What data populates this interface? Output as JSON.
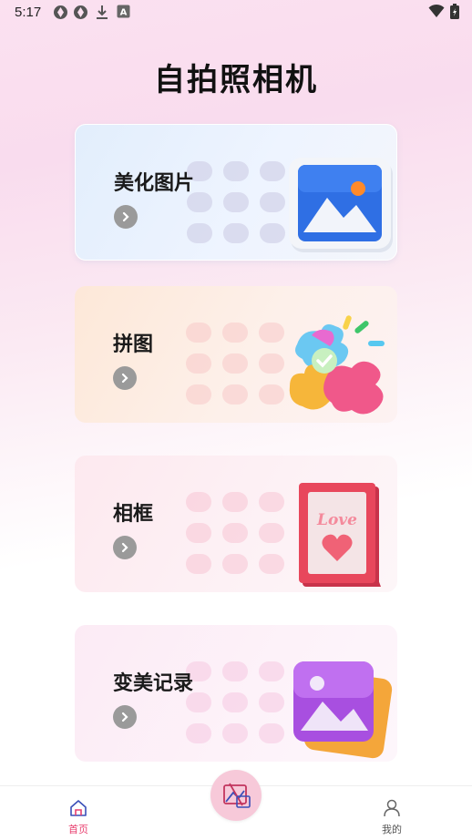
{
  "status_bar": {
    "time": "5:17",
    "icons": [
      "aperture-icon",
      "aperture-icon",
      "download-icon",
      "font-icon",
      "wifi-icon",
      "battery-charging-icon"
    ]
  },
  "page": {
    "title": "自拍照相机"
  },
  "cards": [
    {
      "label": "美化图片",
      "icon": "photo-frame-icon",
      "accent": "#2f6fe4"
    },
    {
      "label": "拼图",
      "icon": "puzzle-icon",
      "accent": "#f06c8c"
    },
    {
      "label": "相框",
      "icon": "love-frame-icon",
      "accent": "#e8475c",
      "art_text": "Love"
    },
    {
      "label": "变美记录",
      "icon": "photo-stack-icon",
      "accent": "#b35ee8"
    }
  ],
  "bottom_nav": {
    "home_label": "首页",
    "center_icon": "photo-edit-icon",
    "mine_label": "我的",
    "active_color": "#e83e6e"
  }
}
